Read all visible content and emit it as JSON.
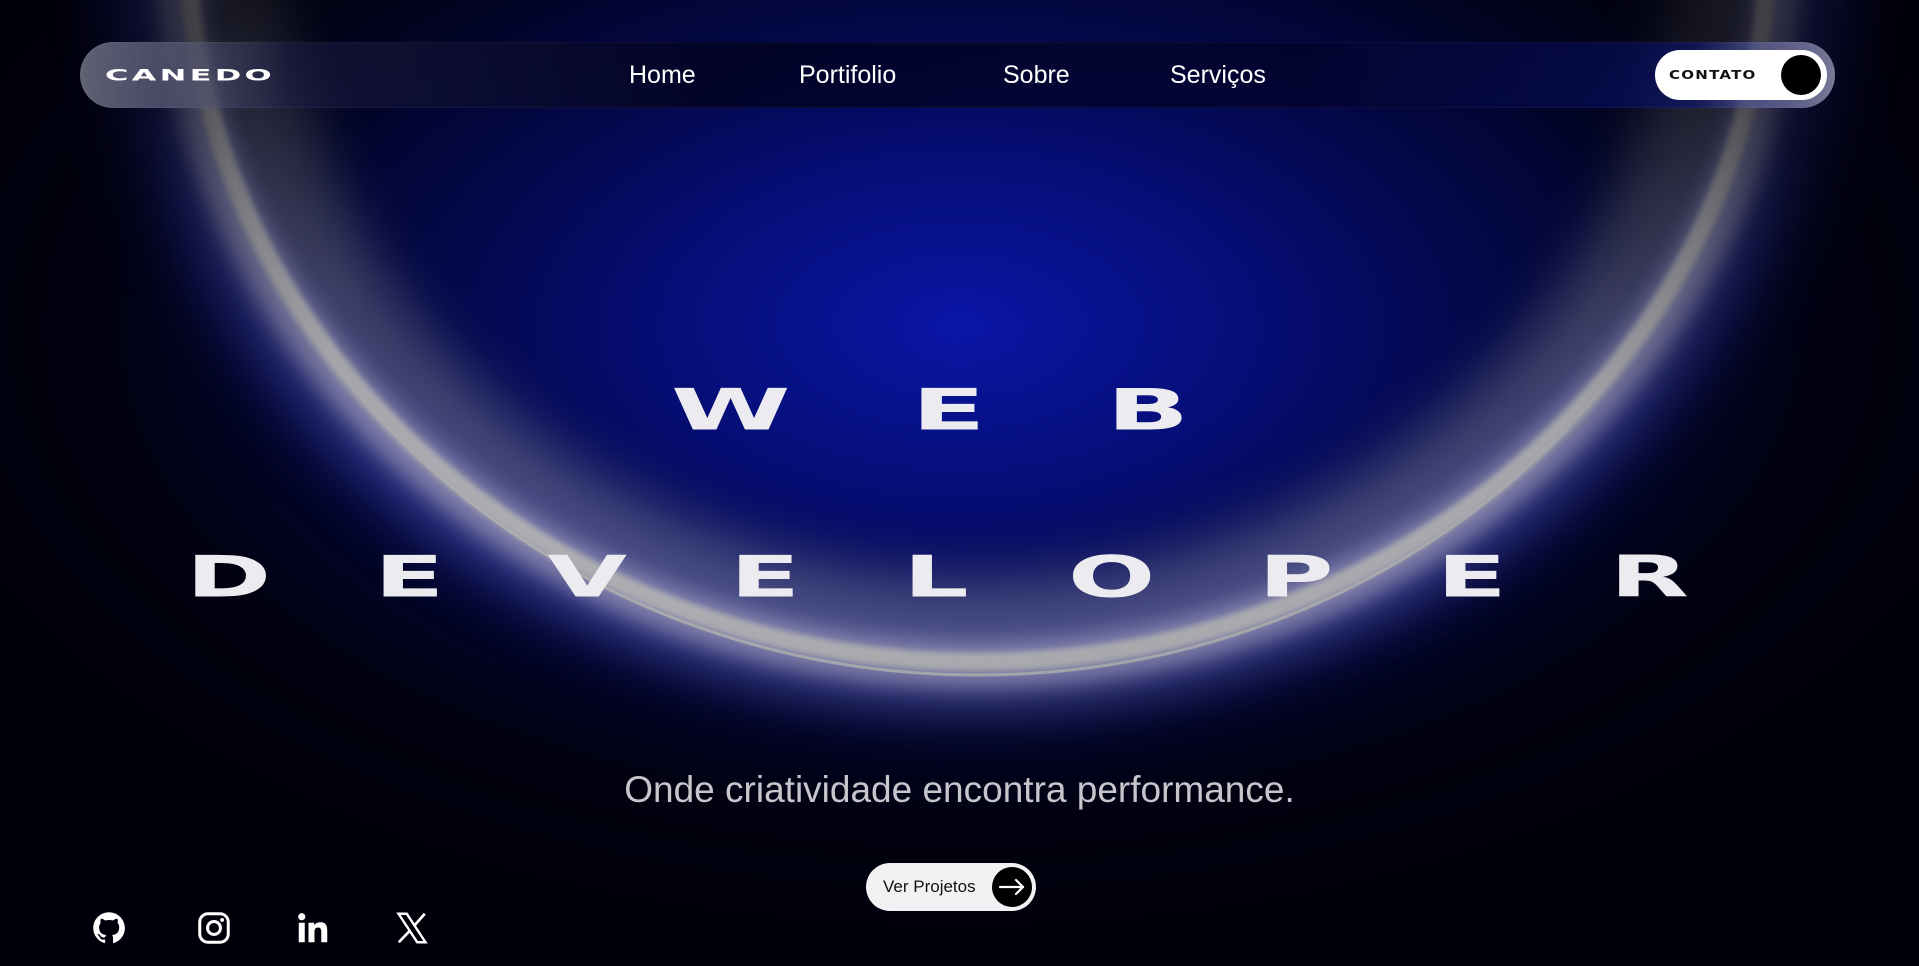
{
  "brand": {
    "logo_text": "CANEDO"
  },
  "nav": {
    "items": [
      {
        "label": "Home"
      },
      {
        "label": "Portifolio"
      },
      {
        "label": "Sobre"
      },
      {
        "label": "Serviços"
      }
    ],
    "contact_label": "CONTATO"
  },
  "hero": {
    "line1": "WEB",
    "line2": "DEVELOPER",
    "subtitle": "Onde criatividade encontra performance.",
    "cta_label": "Ver Projetos"
  },
  "social": [
    {
      "icon": "github-icon"
    },
    {
      "icon": "instagram-icon"
    },
    {
      "icon": "linkedin-icon"
    },
    {
      "icon": "x-icon"
    }
  ],
  "colors": {
    "background": "#02021a",
    "accent_blue": "#0a16a8",
    "text": "#ececf0"
  }
}
